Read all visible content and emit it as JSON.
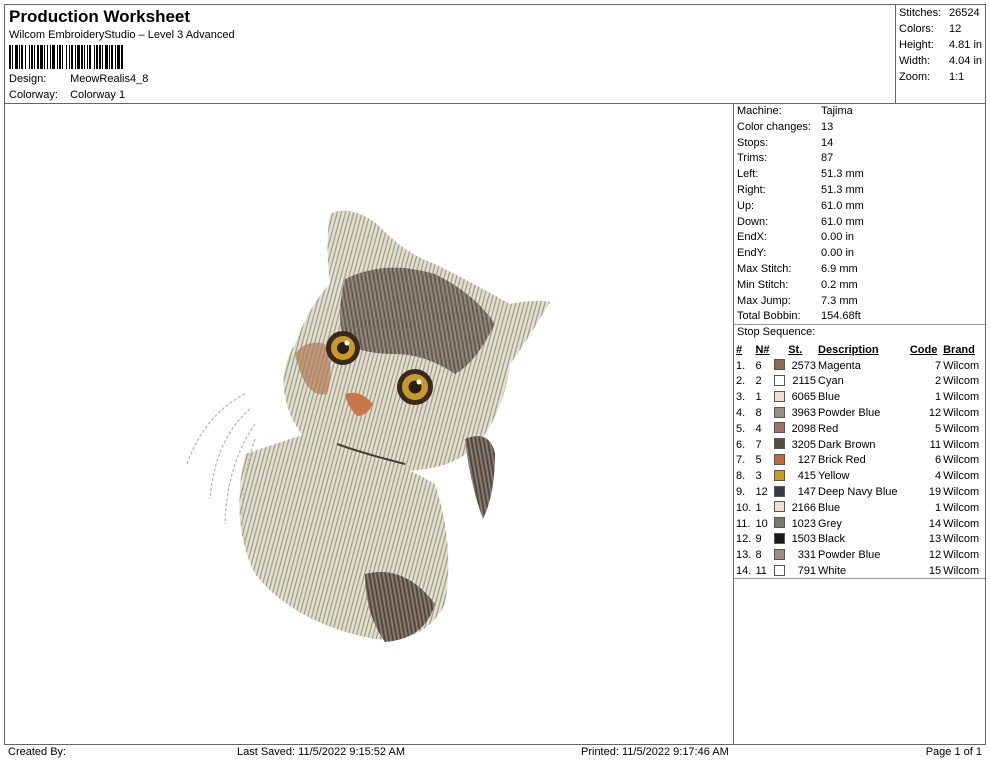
{
  "header": {
    "title": "Production Worksheet",
    "subtitle": "Wilcom EmbroideryStudio – Level 3 Advanced",
    "design_label": "Design:",
    "design_value": "MeowRealis4_8",
    "colorway_label": "Colorway:",
    "colorway_value": "Colorway 1"
  },
  "stats": [
    {
      "label": "Stitches:",
      "value": "26524"
    },
    {
      "label": "Colors:",
      "value": "12"
    },
    {
      "label": "Height:",
      "value": "4.81 in"
    },
    {
      "label": "Width:",
      "value": "4.04 in"
    },
    {
      "label": "Zoom:",
      "value": "1:1"
    }
  ],
  "info": [
    {
      "label": "Machine:",
      "value": "Tajima"
    },
    {
      "label": "Color changes:",
      "value": "13"
    },
    {
      "label": "Stops:",
      "value": "14"
    },
    {
      "label": "Trims:",
      "value": "87"
    },
    {
      "label": "Left:",
      "value": "51.3 mm"
    },
    {
      "label": "Right:",
      "value": "51.3 mm"
    },
    {
      "label": "Up:",
      "value": "61.0 mm"
    },
    {
      "label": "Down:",
      "value": "61.0 mm"
    },
    {
      "label": "EndX:",
      "value": "0.00 in"
    },
    {
      "label": "EndY:",
      "value": "0.00 in"
    },
    {
      "label": "Max Stitch:",
      "value": "6.9 mm"
    },
    {
      "label": "Min Stitch:",
      "value": "0.2 mm"
    },
    {
      "label": "Max Jump:",
      "value": "7.3 mm"
    },
    {
      "label": "Total Bobbin:",
      "value": "154.68ft"
    }
  ],
  "sequence": {
    "title": "Stop Sequence:",
    "headers": {
      "num": "#",
      "n": "N#",
      "st": "St.",
      "desc": "Description",
      "code": "Code",
      "brand": "Brand"
    },
    "rows": [
      {
        "num": "1.",
        "n": "6",
        "color": "#8a6a52",
        "st": "2573",
        "desc": "Magenta",
        "code": "7",
        "brand": "Wilcom"
      },
      {
        "num": "2.",
        "n": "2",
        "color": "#ffffff",
        "st": "2115",
        "desc": "Cyan",
        "code": "2",
        "brand": "Wilcom"
      },
      {
        "num": "3.",
        "n": "1",
        "color": "#e8e4d0",
        "st": "6065",
        "desc": "Blue",
        "code": "1",
        "brand": "Wilcom"
      },
      {
        "num": "4.",
        "n": "8",
        "color": "#9a8e84",
        "st": "3963",
        "desc": "Powder Blue",
        "code": "12",
        "brand": "Wilcom"
      },
      {
        "num": "5.",
        "n": "4",
        "color": "#a07062",
        "st": "2098",
        "desc": "Red",
        "code": "5",
        "brand": "Wilcom"
      },
      {
        "num": "6.",
        "n": "7",
        "color": "#5a4a4a",
        "st": "3205",
        "desc": "Dark Brown",
        "code": "11",
        "brand": "Wilcom"
      },
      {
        "num": "7.",
        "n": "5",
        "color": "#c06a3a",
        "st": "127",
        "desc": "Brick Red",
        "code": "6",
        "brand": "Wilcom"
      },
      {
        "num": "8.",
        "n": "3",
        "color": "#c8a020",
        "st": "415",
        "desc": "Yellow",
        "code": "4",
        "brand": "Wilcom"
      },
      {
        "num": "9.",
        "n": "12",
        "color": "#3a3a4a",
        "st": "147",
        "desc": "Deep Navy Blue",
        "code": "19",
        "brand": "Wilcom"
      },
      {
        "num": "10.",
        "n": "1",
        "color": "#e8e4d0",
        "st": "2166",
        "desc": "Blue",
        "code": "1",
        "brand": "Wilcom"
      },
      {
        "num": "11.",
        "n": "10",
        "color": "#7a7670",
        "st": "1023",
        "desc": "Grey",
        "code": "14",
        "brand": "Wilcom"
      },
      {
        "num": "12.",
        "n": "9",
        "color": "#1a1a1a",
        "st": "1503",
        "desc": "Black",
        "code": "13",
        "brand": "Wilcom"
      },
      {
        "num": "13.",
        "n": "8",
        "color": "#9a8e84",
        "st": "331",
        "desc": "Powder Blue",
        "code": "12",
        "brand": "Wilcom"
      },
      {
        "num": "14.",
        "n": "11",
        "color": "#ffffff",
        "st": "791",
        "desc": "White",
        "code": "15",
        "brand": "Wilcom"
      }
    ]
  },
  "footer": {
    "created_by": "Created By:",
    "last_saved": "Last Saved: 11/5/2022 9:15:52 AM",
    "printed": "Printed: 11/5/2022 9:17:46 AM",
    "page": "Page 1 of 1"
  }
}
